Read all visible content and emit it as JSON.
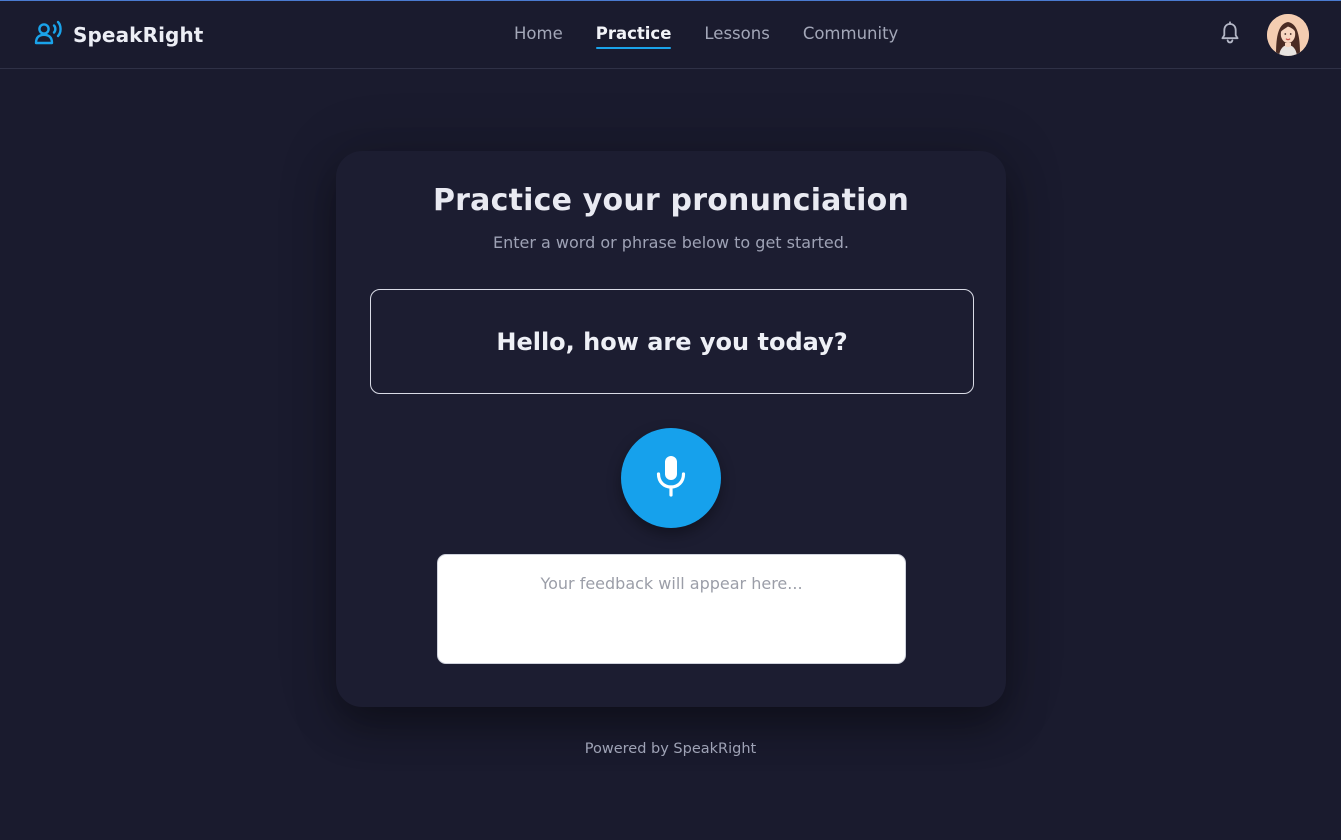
{
  "app": {
    "brand_name": "SpeakRight",
    "accent_color": "#16a1ec"
  },
  "nav": {
    "items": [
      {
        "label": "Home",
        "active": false
      },
      {
        "label": "Practice",
        "active": true
      },
      {
        "label": "Lessons",
        "active": false
      },
      {
        "label": "Community",
        "active": false
      }
    ]
  },
  "header_actions": {
    "notification_icon": "bell-icon",
    "avatar": "user-avatar"
  },
  "practice": {
    "title": "Practice your pronunciation",
    "subtitle": "Enter a word or phrase below to get started.",
    "phrase_value": "Hello, how are you today?",
    "mic_icon": "microphone-icon",
    "feedback_placeholder": "Your feedback will appear here..."
  },
  "footer": {
    "text": "Powered by SpeakRight"
  }
}
